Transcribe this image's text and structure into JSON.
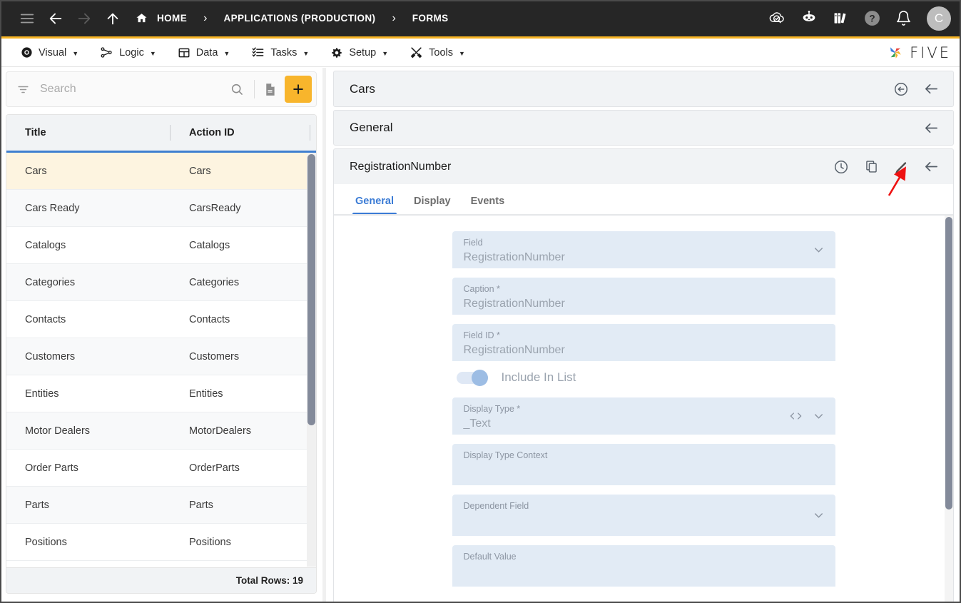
{
  "topbar": {
    "nav_icons": [
      "menu-icon",
      "back-arrow-icon",
      "forward-arrow-icon",
      "up-arrow-icon"
    ],
    "breadcrumbs": [
      {
        "label": "HOME",
        "icon": "home-icon"
      },
      {
        "label": "APPLICATIONS (PRODUCTION)",
        "icon": ""
      },
      {
        "label": "FORMS",
        "icon": ""
      }
    ],
    "separator": "›",
    "right_icons": [
      "cloud-check-icon",
      "robot-icon",
      "books-icon",
      "help-icon",
      "bell-icon"
    ],
    "avatar_initial": "C"
  },
  "menubar": {
    "items": [
      {
        "label": "Visual",
        "icon": "eye-icon",
        "caret": "▼"
      },
      {
        "label": "Logic",
        "icon": "logic-nodes-icon",
        "caret": "▼"
      },
      {
        "label": "Data",
        "icon": "table-icon",
        "caret": "▼"
      },
      {
        "label": "Tasks",
        "icon": "checklist-icon",
        "caret": "▼"
      },
      {
        "label": "Setup",
        "icon": "gear-icon",
        "caret": "▼"
      },
      {
        "label": "Tools",
        "icon": "tools-icon",
        "caret": "▼"
      }
    ],
    "brand": "FIVE"
  },
  "sidebar": {
    "search": {
      "placeholder": "Search",
      "value": ""
    },
    "toolbar_icons": [
      "filter-icon",
      "search-icon",
      "document-icon",
      "add-icon"
    ],
    "add_label": "+",
    "grid": {
      "columns": [
        "Title",
        "Action ID"
      ],
      "rows": [
        {
          "title": "Cars",
          "action_id": "Cars",
          "selected": true
        },
        {
          "title": "Cars Ready",
          "action_id": "CarsReady",
          "selected": false
        },
        {
          "title": "Catalogs",
          "action_id": "Catalogs",
          "selected": false
        },
        {
          "title": "Categories",
          "action_id": "Categories",
          "selected": false
        },
        {
          "title": "Contacts",
          "action_id": "Contacts",
          "selected": false
        },
        {
          "title": "Customers",
          "action_id": "Customers",
          "selected": false
        },
        {
          "title": "Entities",
          "action_id": "Entities",
          "selected": false
        },
        {
          "title": "Motor Dealers",
          "action_id": "MotorDealers",
          "selected": false
        },
        {
          "title": "Order Parts",
          "action_id": "OrderParts",
          "selected": false
        },
        {
          "title": "Parts",
          "action_id": "Parts",
          "selected": false
        },
        {
          "title": "Positions",
          "action_id": "Positions",
          "selected": false
        }
      ],
      "footer": "Total Rows: 19"
    }
  },
  "detail": {
    "level1": {
      "title": "Cars",
      "icons": [
        "history-back-icon",
        "close-panel-arrow-icon"
      ]
    },
    "level2": {
      "title": "General",
      "icons": [
        "close-panel-arrow-icon"
      ]
    },
    "level3": {
      "title": "RegistrationNumber",
      "icons": [
        "clock-icon",
        "copy-icon",
        "edit-pencil-icon",
        "close-panel-arrow-icon"
      ]
    },
    "tabs": [
      {
        "label": "General",
        "active": true
      },
      {
        "label": "Display",
        "active": false
      },
      {
        "label": "Events",
        "active": false
      }
    ],
    "fields": [
      {
        "label": "Field",
        "value": "RegistrationNumber",
        "type": "select"
      },
      {
        "label": "Caption *",
        "value": "RegistrationNumber",
        "type": "text"
      },
      {
        "label": "Field ID *",
        "value": "RegistrationNumber",
        "type": "text"
      },
      {
        "label": "Display Type *",
        "value": "_Text",
        "type": "select-code"
      },
      {
        "label": "Display Type Context",
        "value": "",
        "type": "text"
      },
      {
        "label": "Dependent Field",
        "value": "",
        "type": "select"
      },
      {
        "label": "Default Value",
        "value": "",
        "type": "text"
      }
    ],
    "toggle": {
      "label": "Include In List",
      "on": true
    }
  },
  "colors": {
    "topbar_bg": "#262626",
    "accent_yellow": "#f5b324",
    "selected_row": "#fdf4e0",
    "tab_active": "#3a7bd5",
    "field_bg": "#e2ebf5",
    "annotation_red": "#ee1111"
  }
}
